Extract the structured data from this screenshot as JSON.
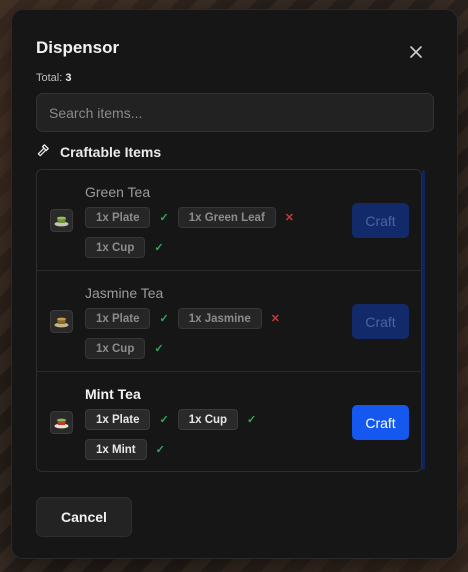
{
  "dialog": {
    "title": "Dispensor",
    "total_label": "Total:",
    "total_value": "3",
    "close_icon": "close-icon"
  },
  "search": {
    "placeholder": "Search items...",
    "value": ""
  },
  "section": {
    "label": "Craftable Items",
    "icon": "hammer-icon"
  },
  "items": [
    {
      "name": "Green Tea",
      "icon": "tea-cup-icon",
      "craft_label": "Craft",
      "craft_enabled": false,
      "ingredients": [
        {
          "label": "1x Plate",
          "status": "ok"
        },
        {
          "label": "1x Green Leaf",
          "status": "missing"
        },
        {
          "label": "1x Cup",
          "status": "ok"
        }
      ]
    },
    {
      "name": "Jasmine Tea",
      "icon": "tea-cup-icon",
      "craft_label": "Craft",
      "craft_enabled": false,
      "ingredients": [
        {
          "label": "1x Plate",
          "status": "ok"
        },
        {
          "label": "1x Jasmine",
          "status": "missing"
        },
        {
          "label": "1x Cup",
          "status": "ok"
        }
      ]
    },
    {
      "name": "Mint Tea",
      "icon": "tea-cup-icon",
      "craft_label": "Craft",
      "craft_enabled": true,
      "ingredients": [
        {
          "label": "1x Plate",
          "status": "ok"
        },
        {
          "label": "1x Cup",
          "status": "ok"
        },
        {
          "label": "1x Mint",
          "status": "ok"
        }
      ]
    }
  ],
  "footer": {
    "cancel_label": "Cancel"
  },
  "colors": {
    "accent": "#1458f0",
    "ok": "#2faa5a",
    "missing": "#c33a3a"
  }
}
